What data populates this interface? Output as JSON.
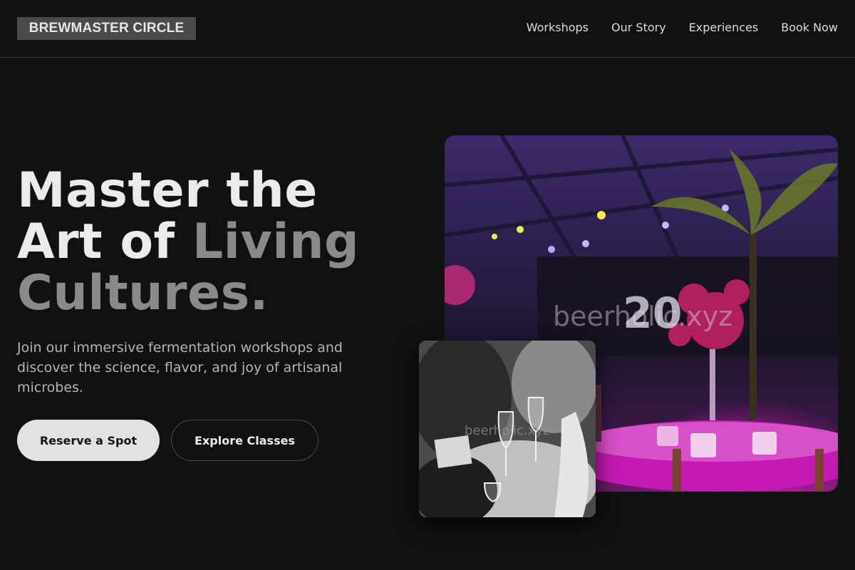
{
  "header": {
    "logo": "BREWMASTER CIRCLE",
    "nav": [
      "Workshops",
      "Our Story",
      "Experiences",
      "Book Now"
    ]
  },
  "hero": {
    "title_line1": "Master the",
    "title_line2_a": "Art of ",
    "title_line2_b": "Living",
    "title_line3": "Cultures.",
    "subtitle": "Join our immersive fermentation workshops and discover the science, flavor, and joy of artisanal microbes.",
    "primary_button": "Reserve a Spot",
    "secondary_button": "Explore Classes"
  },
  "images": {
    "main_watermark": "beerholic.xyz",
    "small_watermark": "beerholic.xyz"
  },
  "colors": {
    "background": "#111111",
    "accent_muted": "#8a8a8a",
    "button_primary": "#e2e2e2"
  }
}
